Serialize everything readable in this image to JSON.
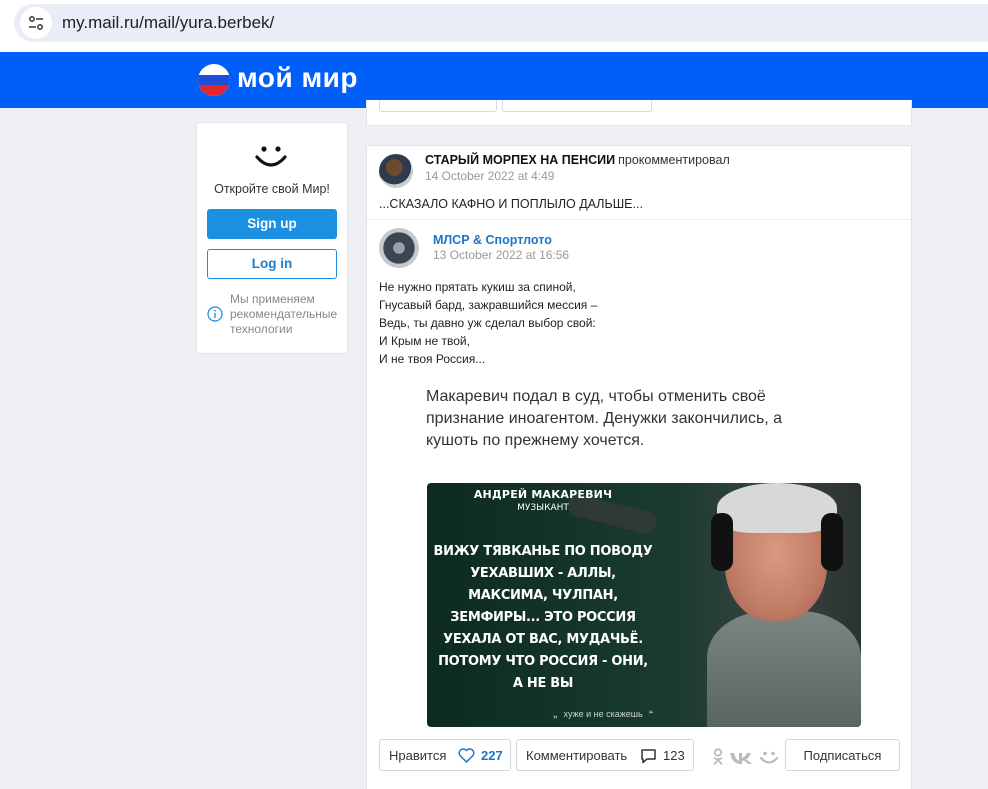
{
  "browser": {
    "url": "my.mail.ru/mail/yura.berbek/"
  },
  "header": {
    "logo_text": "мой мир"
  },
  "sidebar": {
    "title": "Откройте свой Мир!",
    "signup_label": "Sign up",
    "login_label": "Log in",
    "note": "Мы применяем рекомендательные технологии"
  },
  "post": {
    "commenter": {
      "name": "СТАРЫЙ МОРПЕХ НА ПЕНСИИ",
      "action": "прокомментировал",
      "date": "14 October 2022 at 4:49",
      "comment": "...СКАЗАЛО КАФНО И ПОПЛЫЛО ДАЛЬШЕ..."
    },
    "original": {
      "author": "МЛСР & Спортлото",
      "date": "13 October 2022 at 16:56",
      "poem": [
        "Не нужно прятать кукиш за спиной,",
        "Гнусавый бард, зажравшийся мессия –",
        "Ведь, ты давно уж сделал выбор свой:",
        "И Крым не твой,",
        "И не твоя Россия..."
      ],
      "caption": "Макаревич подал в суд, чтобы отменить своё признание иноагентом. Денужки закончились, а кушоть по прежнему хочется."
    },
    "meme": {
      "name": "АНДРЕЙ МАКАРЕВИЧ",
      "role": "МУЗЫКАНТ",
      "quote_lines": [
        "ВИЖУ ТЯВКАНЬЕ ПО ПОВОДУ",
        "УЕХАВШИХ - АЛЛЫ,",
        "МАКСИМА, ЧУЛПАН,",
        "ЗЕМФИРЫ... ЭТО РОССИЯ",
        "УЕХАЛА ОТ ВАС, МУДАЧЬЁ.",
        "ПОТОМУ ЧТО РОССИЯ - ОНИ,",
        "А НЕ ВЫ"
      ],
      "footer": "хуже и не скажешь"
    },
    "actions": {
      "like_label": "Нравится",
      "like_count": "227",
      "comment_label": "Комментировать",
      "comment_count": "123",
      "follow_label": "Подписаться"
    }
  },
  "colors": {
    "header_blue": "#005ff9",
    "button_blue": "#1b8fe0",
    "link_blue": "#1b76c7"
  }
}
